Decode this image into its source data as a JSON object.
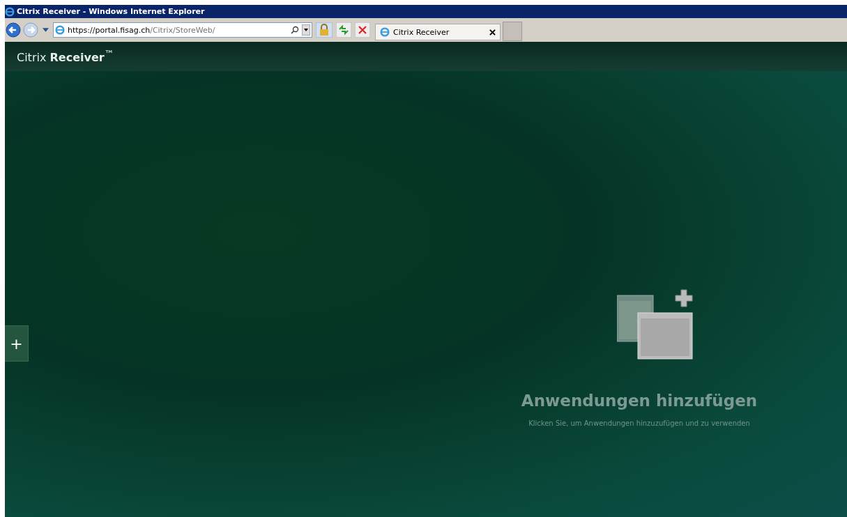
{
  "window": {
    "title": "Citrix Receiver - Windows Internet Explorer"
  },
  "address_bar": {
    "url_host": "https://portal.fisag.ch",
    "url_path": "/Citrix/StoreWeb/"
  },
  "tabs": [
    {
      "label": "Citrix Receiver",
      "selected": true
    }
  ],
  "header": {
    "logo": "Citrix **Receiver**$^{™}$"
  },
  "side_button": {
    "label": "+"
  },
  "empty_state": {
    "title": "Anwendungen hinzufügen",
    "subtitle": "Klicken Sie, um Anwendungen hinzuzufügen und zu verwenden"
  }
}
